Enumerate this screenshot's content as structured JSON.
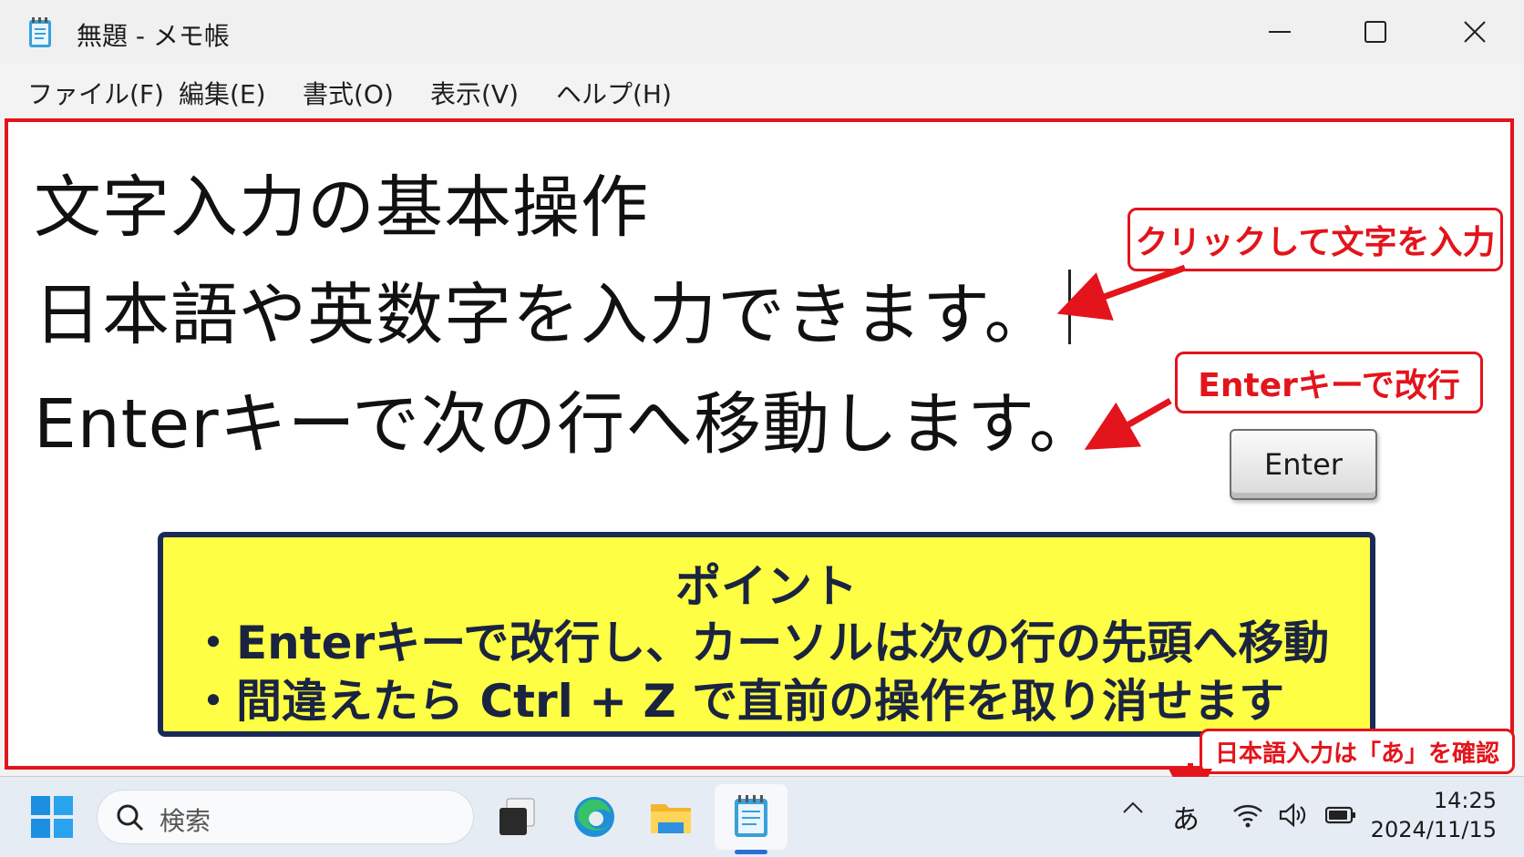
{
  "window": {
    "title": "無題 - メモ帳"
  },
  "menu": {
    "items": [
      "ファイル(F)",
      "編集(E)",
      "書式(O)",
      "表示(V)",
      "ヘルプ(H)"
    ]
  },
  "editor": {
    "lines": [
      "文字入力の基本操作",
      "日本語や英数字を入力できます。",
      "Enterキーで次の行へ移動します。"
    ]
  },
  "annotations": {
    "click_callout": "クリックして文字を入力",
    "enter_callout": "Enterキーで改行",
    "enter_key_label": "Enter",
    "ime_callout": "日本語入力は「あ」を確認"
  },
  "point": {
    "title": "ポイント",
    "bullets": [
      "・Enterキーで改行し、カーソルは次の行の先頭へ移動",
      "・間違えたら Ctrl + Z で直前の操作を取り消せます"
    ]
  },
  "taskbar": {
    "search_placeholder": "検索",
    "tray_chevron": "^",
    "ime_indicator": "あ",
    "time": "14:25",
    "date": "2024/11/15"
  },
  "colors": {
    "accent_red": "#e3141b",
    "point_bg": "#fefe44",
    "point_border": "#1a2a58"
  }
}
